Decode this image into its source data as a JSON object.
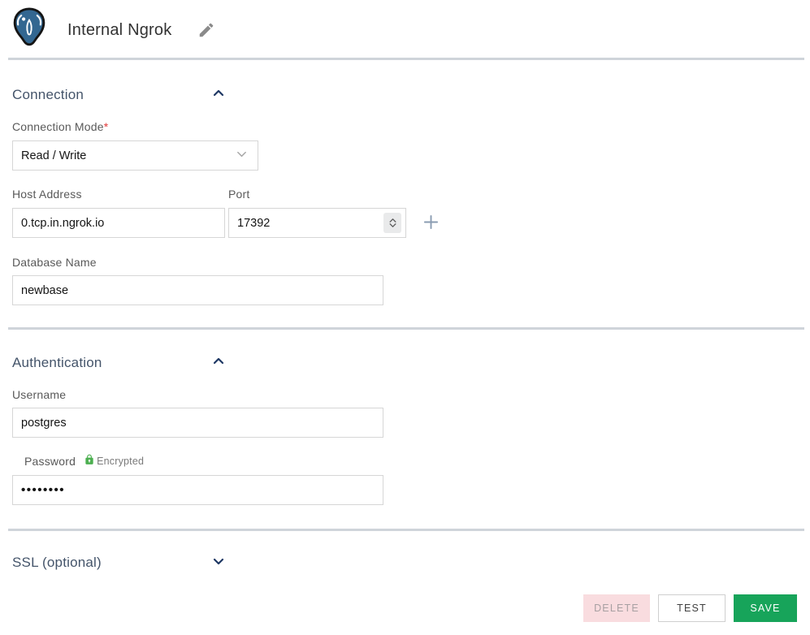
{
  "header": {
    "title": "Internal Ngrok"
  },
  "sections": {
    "connection": {
      "title": "Connection",
      "connection_mode": {
        "label": "Connection Mode",
        "required_mark": "*",
        "value": "Read / Write"
      },
      "host_address": {
        "label": "Host Address",
        "value": "0.tcp.in.ngrok.io"
      },
      "port": {
        "label": "Port",
        "value": "17392"
      },
      "database_name": {
        "label": "Database Name",
        "value": "newbase"
      }
    },
    "authentication": {
      "title": "Authentication",
      "username": {
        "label": "Username",
        "value": "postgres"
      },
      "password": {
        "label": "Password",
        "badge": "Encrypted",
        "value": "••••••••"
      }
    },
    "ssl": {
      "title": "SSL (optional)"
    }
  },
  "actions": {
    "delete": "DELETE",
    "test": "TEST",
    "save": "SAVE"
  },
  "colors": {
    "postgres_blue": "#336791",
    "heading": "#44546a",
    "save_green": "#17a45a",
    "delete_bg": "#f9dcdf",
    "lock_green": "#4caf50",
    "required_red": "#e23b3b",
    "divider": "#cfd4da"
  }
}
